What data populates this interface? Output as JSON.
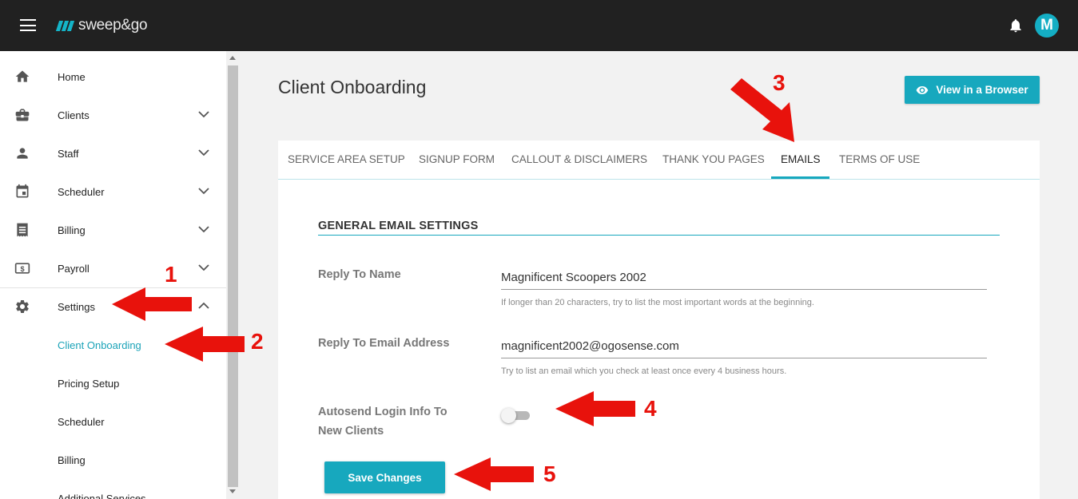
{
  "app": {
    "logo_text": "sweep&go",
    "avatar_initial": "M",
    "brand_color": "#17a8be"
  },
  "sidebar": {
    "items": [
      {
        "label": "Home",
        "icon": "home-icon"
      },
      {
        "label": "Clients",
        "icon": "briefcase-icon"
      },
      {
        "label": "Staff",
        "icon": "person-icon"
      },
      {
        "label": "Scheduler",
        "icon": "calendar-icon"
      },
      {
        "label": "Billing",
        "icon": "receipt-icon"
      },
      {
        "label": "Payroll",
        "icon": "dollar-icon"
      },
      {
        "label": "Settings",
        "icon": "gear-icon"
      }
    ],
    "sub_items": [
      {
        "label": "Client Onboarding",
        "active": true
      },
      {
        "label": "Pricing Setup"
      },
      {
        "label": "Scheduler"
      },
      {
        "label": "Billing"
      },
      {
        "label": "Additional Services"
      }
    ]
  },
  "main": {
    "title": "Client Onboarding",
    "view_button": "View in a Browser",
    "tabs": [
      {
        "label": "SERVICE AREA SETUP"
      },
      {
        "label": "SIGNUP FORM"
      },
      {
        "label": "CALLOUT & DISCLAIMERS"
      },
      {
        "label": "THANK YOU PAGES"
      },
      {
        "label": "EMAILS",
        "active": true
      },
      {
        "label": "TERMS OF USE"
      }
    ],
    "section_title": "GENERAL EMAIL SETTINGS",
    "reply_name": {
      "label": "Reply To Name",
      "value": "Magnificent Scoopers 2002",
      "hint": "If longer than 20 characters, try to list the most important words at the beginning."
    },
    "reply_email": {
      "label": "Reply To Email Address",
      "value": "magnificent2002@ogosense.com",
      "hint": "Try to list an email which you check at least once every 4 business hours."
    },
    "autosend": {
      "label_line1": "Autosend Login Info To",
      "label_line2": "New Clients",
      "enabled": false
    },
    "save_button": "Save Changes"
  },
  "annotations": {
    "one": "1",
    "two": "2",
    "three": "3",
    "four": "4",
    "five": "5",
    "color": "#e8120c"
  }
}
